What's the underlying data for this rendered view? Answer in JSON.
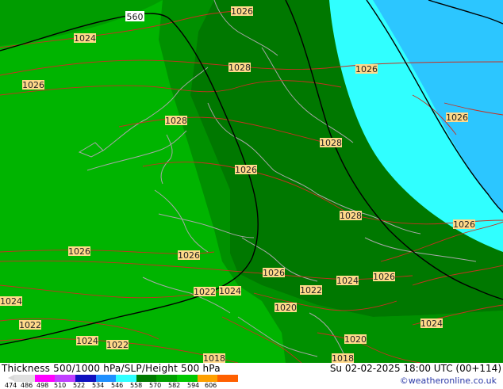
{
  "title": "Thickness 500/1000 hPa/SLP/Height 500 hPa",
  "datetime": "Su 02-02-2025 18:00 UTC (00+114)",
  "credit": "©weatheronline.co.uk",
  "legend": {
    "ticks": [
      "474",
      "486",
      "498",
      "510",
      "522",
      "534",
      "546",
      "558",
      "570",
      "582",
      "594",
      "606"
    ],
    "colors": [
      "#e0e0e0",
      "#ff00ff",
      "#c040ff",
      "#1010c0",
      "#2090ff",
      "#30ffff",
      "#007a00",
      "#00a000",
      "#00c800",
      "#ffa000",
      "#ff6000"
    ]
  },
  "colors": {
    "band_light_green": "#00b400",
    "band_mid_green": "#009000",
    "band_dark_green": "#007800",
    "band_cyan": "#30ffff",
    "band_light_blue": "#2cc6ff",
    "isobar": "#c83020",
    "height_contour": "#000000",
    "border": "#a8a8a8"
  },
  "map": {
    "height_label": "560",
    "pressure_labels": [
      "1026",
      "1024",
      "1026",
      "1028",
      "1026",
      "1028",
      "1026",
      "1028",
      "1026",
      "1028",
      "1026",
      "1026",
      "1026",
      "1022",
      "1024",
      "1026",
      "1022",
      "1024",
      "1026",
      "1020",
      "1022",
      "1024",
      "1022",
      "1020",
      "1018",
      "1018",
      "1024",
      "1024"
    ]
  }
}
